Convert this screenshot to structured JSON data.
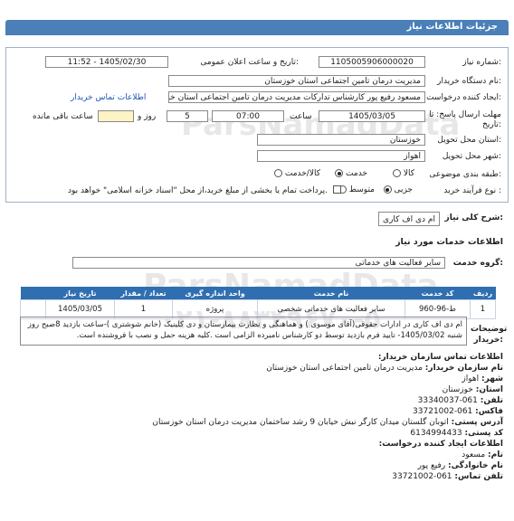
{
  "header": {
    "title": "جزئیات اطلاعات نیاز"
  },
  "form": {
    "need_number_label": "شماره نیاز:",
    "need_number": "1105005906000020",
    "announce_label": "تاریخ و ساعت اعلان عمومی:",
    "announce_value": "1405/02/30 - 11:52",
    "buyer_org_label": "نام دستگاه خریدار:",
    "buyer_org": "مدیریت درمان تامین اجتماعی استان خوزستان",
    "creator_label": "ایجاد کننده درخواست:",
    "creator": "مسعود رفیع پور کارشناس تدارکات مدیریت درمان تامین اجتماعی استان خوزستان",
    "contact_link": "اطلاعات تماس خریدار",
    "deadline_label": "مهلت ارسال پاسخ: تا تاریخ:",
    "deadline_date": "1405/03/05",
    "hour_label": "ساعت",
    "deadline_time": "07:00",
    "days": "5",
    "days_label": "روز و",
    "remaining_label": "ساعت باقی مانده",
    "province_label": "استان محل تحویل:",
    "province": "خوزستان",
    "city_label": "شهر محل تحویل:",
    "city": "اهواز",
    "category_label": "طبقه بندی موضوعی:",
    "category_options": [
      "کالا",
      "خدمت",
      "کالا/خدمت"
    ],
    "category_selected": "خدمت",
    "process_label": "نوع فرآیند خرید :",
    "process_options": [
      "جزیی",
      "متوسط"
    ],
    "process_selected": "جزیی",
    "payment_note": "پرداخت تمام یا بخشی از مبلغ خرید،از محل \"اسناد خزانه اسلامی\" خواهد بود."
  },
  "summary": {
    "label": "شرح کلی نیاز:",
    "value": "ام دی اف کاری"
  },
  "services": {
    "title": "اطلاعات خدمات مورد نیاز",
    "group_label": "گروه خدمت:",
    "group_value": "سایر فعالیت های خدماتی",
    "columns": [
      "ردیف",
      "کد خدمت",
      "نام خدمت",
      "واحد اندازه گیری",
      "تعداد / مقدار",
      "تاریخ نیاز"
    ],
    "rows": [
      {
        "row": "1",
        "code": "ط-96-960",
        "name": "سایر فعالیت های خدماتی شخصی",
        "unit": "پروژه",
        "qty": "1",
        "date": "1405/03/05"
      }
    ]
  },
  "buyer_notes": {
    "label": "توضیحات خریدار:",
    "text": "ام دی اف کاری در ادارات حقوقی(آقای موسوی ) و هماهنگی و نظارت بیمارستان و دی کلینیک (خانم شوشتری )-ساعت بازدید 8صبح روز شنبه 1405/03/02- تایید فرم بازدید توسط دو کارشناس نامبرده الزامی است .کلیه هزینه حمل و نصب با فروشنده است."
  },
  "contact": {
    "title": "اطلاعات تماس سازمان خریدار:",
    "org_label": "نام سازمان خریدار:",
    "org": "مدیریت درمان تامین اجتماعی استان خوزستان",
    "city_label": "شهر:",
    "city": "اهواز",
    "province_label": "استان:",
    "province": "خوزستان",
    "phone_label": "تلفن:",
    "phone": "061-33340037",
    "fax_label": "فاکس:",
    "fax": "061-33721002",
    "address_label": "آدرس پستی:",
    "address": "اتوبان گلستان میدان کارگر نبش خیابان 9 رشد ساختمان مدیریت درمان استان خوزستان",
    "postal_label": "کد پستی:",
    "postal": "6134994433",
    "creator_title": "اطلاعات ایجاد کننده درخواست:",
    "first_name_label": "نام:",
    "first_name": "مسعود",
    "last_name_label": "نام خانوادگی:",
    "last_name": "رفیع پور",
    "creator_phone_label": "تلفن تماس:",
    "creator_phone": "061-33721002"
  },
  "watermark": {
    "line1": "ParsNamadData",
    "line2": "۰۲۱-۸۸۳۴۹۶۷۰-۵"
  }
}
